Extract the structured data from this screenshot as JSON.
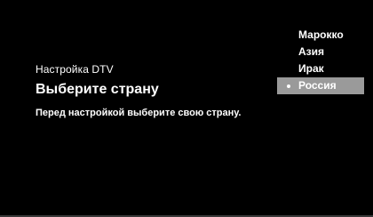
{
  "screen": {
    "background": "#000000",
    "highlight_color": "#9a9a9a"
  },
  "setup": {
    "title": "Настройка DTV",
    "heading": "Выберите страну",
    "hint": "Перед настройкой выберите свою страну."
  },
  "country_menu": {
    "items": [
      {
        "label": "Марокко",
        "selected": false
      },
      {
        "label": "Азия",
        "selected": false
      },
      {
        "label": "Ирак",
        "selected": false
      },
      {
        "label": "Россия",
        "selected": true
      }
    ],
    "selected_marker_icon": "bullet-icon"
  }
}
